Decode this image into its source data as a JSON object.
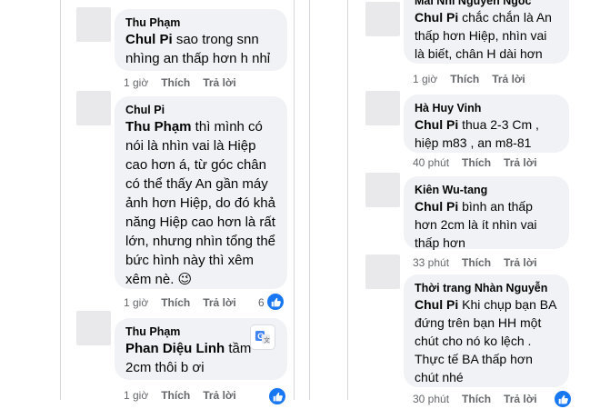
{
  "left": {
    "c1": {
      "author": "Thu Phạm",
      "mention": "Chul Pi",
      "text": " sao trong snn nhìng an thấp hơn h nhỉ",
      "time": "1 giờ",
      "like": "Thích",
      "reply": "Trả lời"
    },
    "c2": {
      "author": "Chul Pi",
      "mention": "Thu Phạm",
      "text": " thì mình có nói là nhìn vai là Hiệp cao hơn á, từ góc chân có thể thấy An gần máy ảnh hơn Hiệp, do đó khả năng Hiệp cao hơn là rất lớn, nhưng nhìn tổng thể bức hình này thì xêm xêm nè. 😉",
      "time": "1 giờ",
      "like": "Thích",
      "reply": "Trả lời",
      "reactions": "6"
    },
    "c3": {
      "author": "Thu Phạm",
      "mention": "Phan Diệu Linh",
      "text": " tầm 2cm thôi b ơi",
      "time": "1 giờ",
      "like": "Thích",
      "reply": "Trả lời"
    }
  },
  "right": {
    "c1": {
      "author": "Mai Nhi Nguyen Ngoc",
      "mention": "Chul Pi",
      "text": " chắc chắn là An thấp hơn Hiệp, nhìn vai là biết, chân H dài hơn",
      "time": "1 giờ",
      "like": "Thích",
      "reply": "Trả lời"
    },
    "c2": {
      "author": "Hà Huy Vinh",
      "mention": "Chul Pi",
      "text": " thua 2-3 Cm , hiệp m83 , an m8-81",
      "time": "40 phút",
      "like": "Thích",
      "reply": "Trả lời"
    },
    "c3": {
      "author": "Kiên Wu-tang",
      "mention": "Chul Pi",
      "text": " bình an thấp hơn 2cm là ít nhìn vai thấp hơn",
      "time": "33 phút",
      "like": "Thích",
      "reply": "Trả lời"
    },
    "c4": {
      "author": "Thời trang Nhàn Nguyễn",
      "mention": "Chul Pi",
      "text": " Khi chụp bạn BA đứng trên bạn HH một chút cho nó ko lệch . Thực tế BA thấp hơn chút nhé",
      "time": "30 phút",
      "like": "Thích",
      "reply": "Trả lời"
    }
  },
  "colors": {
    "bubble": "#f0f2f5",
    "meta": "#65676b",
    "like_blue": "#1877f2"
  },
  "icons": {
    "like": "thumbs-up-icon",
    "translate": "translate-icon"
  }
}
